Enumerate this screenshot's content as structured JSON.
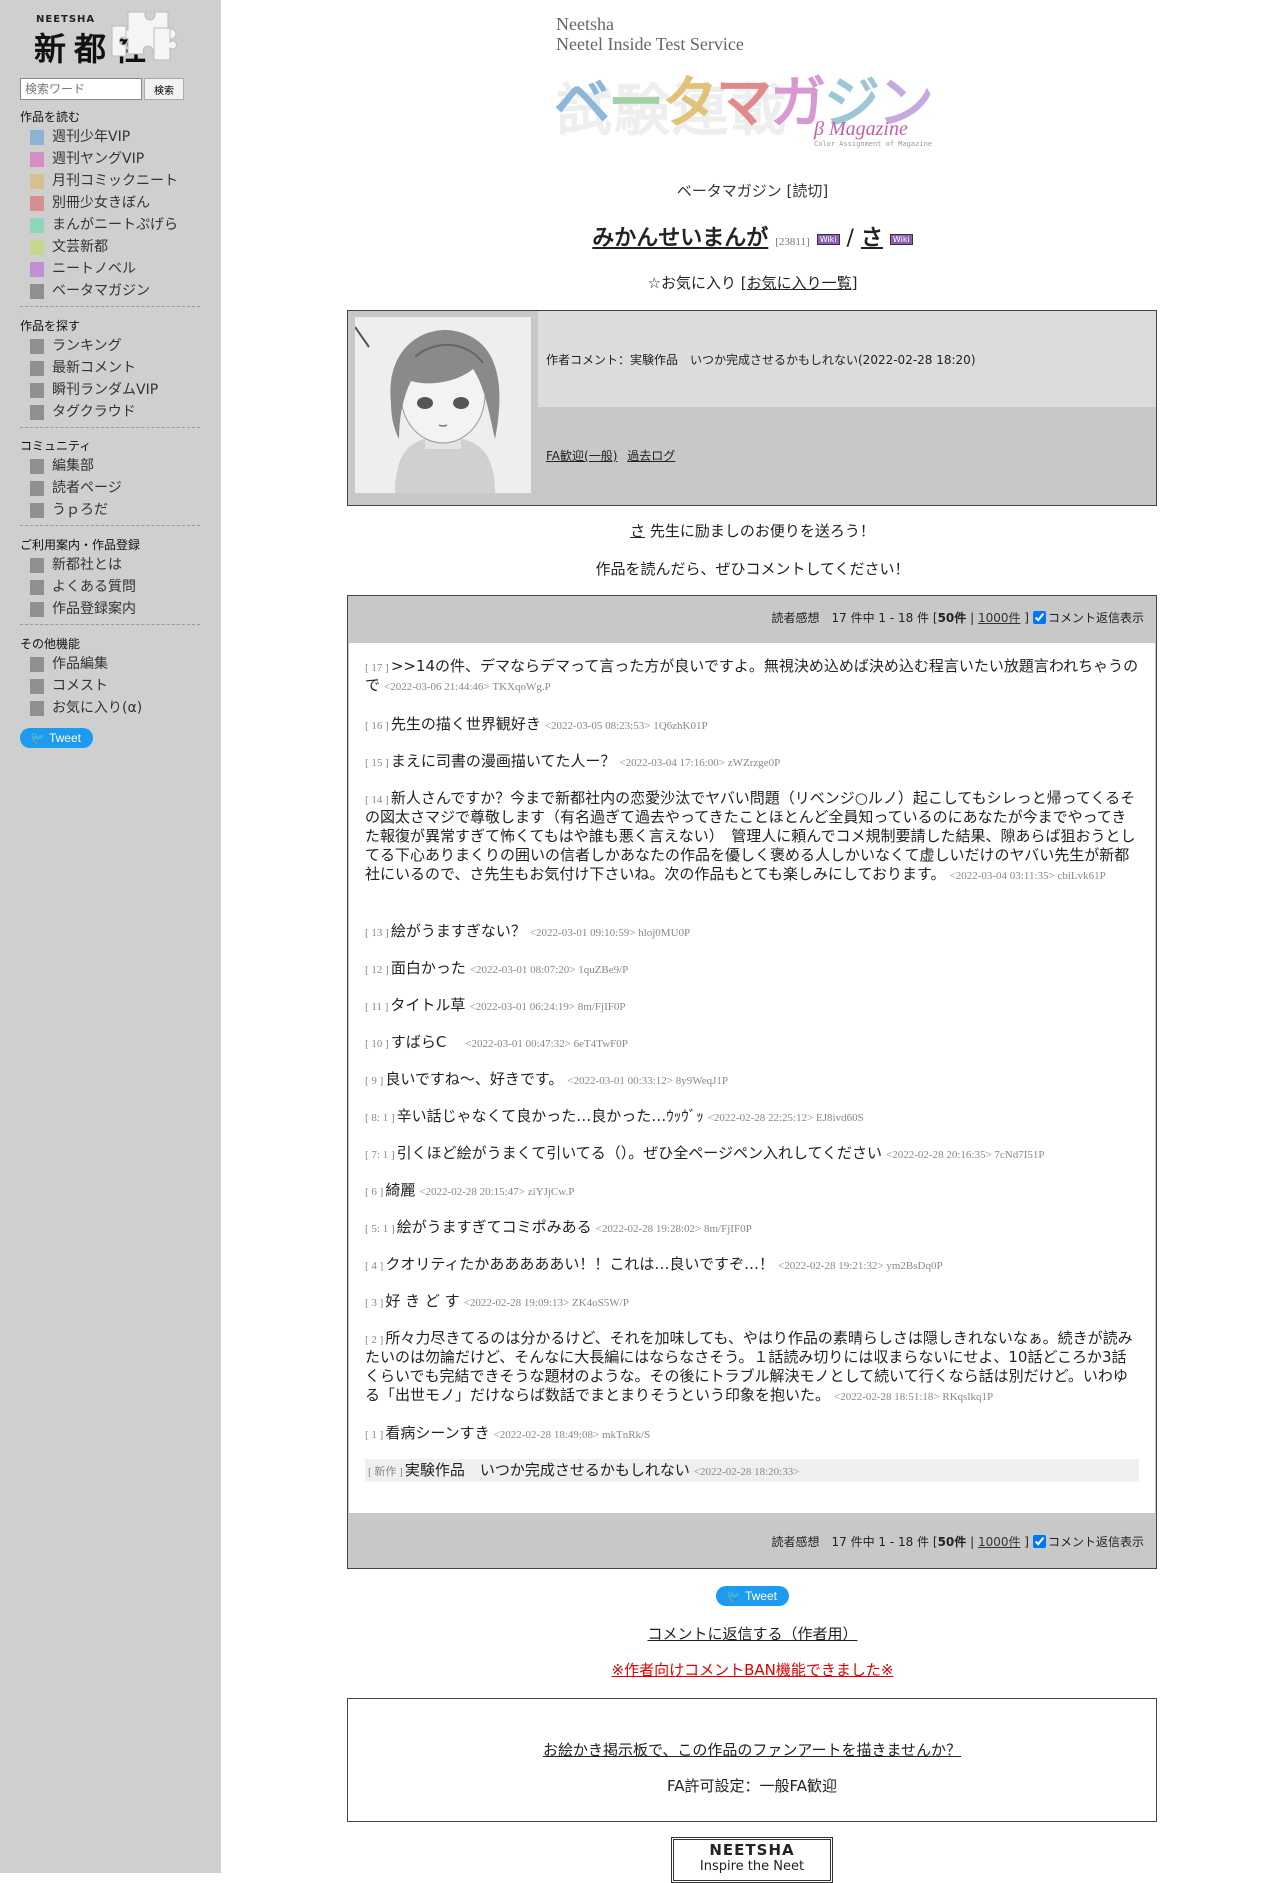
{
  "sidebar": {
    "logo_small": "NEETSHA",
    "logo_big": "新都社",
    "search_placeholder": "検索ワード",
    "search_button": "検索",
    "sections": [
      {
        "title": "作品を読む",
        "items": [
          {
            "label": "週刊少年VIP",
            "color": "#8fb3d6"
          },
          {
            "label": "週刊ヤングVIP",
            "color": "#d68fc4"
          },
          {
            "label": "月刊コミックニート",
            "color": "#d6c08f"
          },
          {
            "label": "別冊少女きぼん",
            "color": "#d68f8f"
          },
          {
            "label": "まんがニートぷげら",
            "color": "#8fd6b8"
          },
          {
            "label": "文芸新都",
            "color": "#c4d68f"
          },
          {
            "label": "ニートノベル",
            "color": "#c08fd6"
          },
          {
            "label": "ベータマガジン",
            "color": "#8f8f8f"
          }
        ]
      },
      {
        "title": "作品を探す",
        "items": [
          {
            "label": "ランキング",
            "color": "#8f8f8f"
          },
          {
            "label": "最新コメント",
            "color": "#8f8f8f"
          },
          {
            "label": "瞬刊ランダムVIP",
            "color": "#8f8f8f"
          },
          {
            "label": "タグクラウド",
            "color": "#8f8f8f"
          }
        ]
      },
      {
        "title": "コミュニティ",
        "items": [
          {
            "label": "編集部",
            "color": "#8f8f8f"
          },
          {
            "label": "読者ページ",
            "color": "#8f8f8f"
          },
          {
            "label": "うｐろだ",
            "color": "#8f8f8f"
          }
        ]
      },
      {
        "title": "ご利用案内・作品登録",
        "items": [
          {
            "label": "新都社とは",
            "color": "#8f8f8f"
          },
          {
            "label": "よくある質問",
            "color": "#8f8f8f"
          },
          {
            "label": "作品登録案内",
            "color": "#8f8f8f"
          }
        ]
      },
      {
        "title": "その他機能",
        "items": [
          {
            "label": "作品編集",
            "color": "#8f8f8f"
          },
          {
            "label": "コメスト",
            "color": "#8f8f8f"
          },
          {
            "label": "お気に入り(α)",
            "color": "#8f8f8f"
          }
        ]
      }
    ],
    "tweet_label": "Tweet"
  },
  "header": {
    "line1": "Neetsha",
    "line2": "Neetel Inside Test Service",
    "title": "ベータマガジン",
    "bg_text": "試験連載",
    "subtitle": "β Magazine",
    "tiny": "Color Assignment of Magazine"
  },
  "work": {
    "magazine_line": "ベータマガジン [読切]",
    "title": "みかんせいまんが",
    "count": "[23811]",
    "wiki": "Wiki",
    "author": "さ",
    "fav": "☆お気に入り",
    "fav_list": "お気に入り一覧",
    "author_comment": "作者コメント：実験作品　いつか完成させるかもしれない(2022-02-28 18:20)",
    "link_fa": "FA歓迎(一般)",
    "link_log": "過去ログ"
  },
  "encourage": {
    "author": "さ",
    "line1_rest": " 先生に励ましのお便りを送ろう！",
    "line2": "作品を読んだら、ぜひコメントしてください！"
  },
  "comments_bar": {
    "label": "読者感想　17 件中 1 - 18 件 [",
    "opt1": "50件",
    "sep": " | ",
    "opt2": "1000件",
    "close": " ]",
    "checkbox": "コメント返信表示"
  },
  "comments": [
    {
      "no": "[ 17 ]",
      "text": ">>14の件、デマならデマって言った方が良いですよ。無視決め込めば決め込む程言いたい放題言われちゃうので",
      "meta": "<2022-03-06 21:44:46> TKXqoWg.P"
    },
    {
      "no": "[ 16 ]",
      "text": "先生の描く世界観好き",
      "meta": "<2022-03-05 08:23:53> 1Q6zhK01P"
    },
    {
      "no": "[ 15 ]",
      "text": "まえに司書の漫画描いてた人ー？",
      "meta": "<2022-03-04 17:16:00> zWZrzge0P"
    },
    {
      "no": "[ 14 ]",
      "text": "新人さんですか？今まで新都社内の恋愛沙汰でヤバい問題（リベンジ○ルノ）起こしてもシレっと帰ってくるその図太さマジで尊敬します（有名過ぎて過去やってきたことほとんど全員知っているのにあなたが今までやってきた報復が異常すぎて怖くてもはや誰も悪く言えない）　管理人に頼んでコメ規制要請した結果、隙あらば狙おうとしてる下心ありまくりの囲いの信者しかあなたの作品を優しく褒める人しかいなくて虚しいだけのヤバい先生が新都社にいるので、さ先生もお気付け下さいね。次の作品もとても楽しみにしております。",
      "meta": "<2022-03-04 03:11:35> cbiLvk61P"
    },
    {
      "no": "[ 13 ]",
      "text": "絵がうますぎない？",
      "meta": "<2022-03-01 09:10:59> hloj0MU0P"
    },
    {
      "no": "[ 12 ]",
      "text": "面白かった",
      "meta": "<2022-03-01 08:07:20> 1quZBe9/P"
    },
    {
      "no": "[ 11 ]",
      "text": "タイトル草",
      "meta": "<2022-03-01 06:24:19> 8m/FjIF0P"
    },
    {
      "no": "[ 10 ]",
      "text": "すばらC　",
      "meta": "<2022-03-01 00:47:32> 6eT4TwF0P"
    },
    {
      "no": "[ 9 ]",
      "text": "良いですね～、好きです。",
      "meta": "<2022-03-01 00:33:12> 8y9WeqJ1P"
    },
    {
      "no": "[ 8: 1 ]",
      "text": "辛い話じゃなくて良かった…良かった…ｳｯｳﾞｯ",
      "meta": "<2022-02-28 22:25:12> EJ8ivd60S"
    },
    {
      "no": "[ 7: 1 ]",
      "text": "引くほど絵がうまくて引いてる（）。ぜひ全ページペン入れしてください",
      "meta": "<2022-02-28 20:16:35> 7cNd7I51P"
    },
    {
      "no": "[ 6 ]",
      "text": "綺麗",
      "meta": "<2022-02-28 20:15:47> ziYJjCw.P"
    },
    {
      "no": "[ 5: 1 ]",
      "text": "絵がうますぎてコミポみある",
      "meta": "<2022-02-28 19:28:02> 8m/FjIF0P"
    },
    {
      "no": "[ 4 ]",
      "text": "クオリティたかあああああい！！これは…良いですぞ…！",
      "meta": "<2022-02-28 19:21:32> ym2BsDq0P"
    },
    {
      "no": "[ 3 ]",
      "text": "好 き ど す",
      "meta": "<2022-02-28 19:09:13> ZK4oS5W/P"
    },
    {
      "no": "[ 2 ]",
      "text": "所々力尽きてるのは分かるけど、それを加味しても、やはり作品の素晴らしさは隠しきれないなぁ。続きが読みたいのは勿論だけど、そんなに大長編にはならなさそう。１話読み切りには収まらないにせよ、10話どころか3話くらいでも完結できそうな題材のような。その後にトラブル解決モノとして続いて行くなら話は別だけど。いわゆる「出世モノ」だけならば数話でまとまりそうという印象を抱いた。",
      "meta": "<2022-02-28 18:51:18> RKqslkq1P"
    },
    {
      "no": "[ 1 ]",
      "text": "看病シーンすき",
      "meta": "<2022-02-28 18:49:08> mkTnRk/S"
    },
    {
      "no": "[ 新作 ]",
      "text": "実験作品　いつか完成させるかもしれない",
      "meta": "<2022-02-28 18:20:33>"
    }
  ],
  "footer": {
    "tweet_label": "Tweet",
    "reply_link": "コメントに返信する（作者用）",
    "ban_link": "※作者向けコメントBAN機能できました※",
    "fa_link": "お絵かき掲示板で、この作品のファンアートを描きませんか？",
    "fa_setting": "FA許可設定：一般FA歓迎",
    "logo_top": "NEETSHA",
    "logo_bottom": "Inspire the Neet"
  }
}
